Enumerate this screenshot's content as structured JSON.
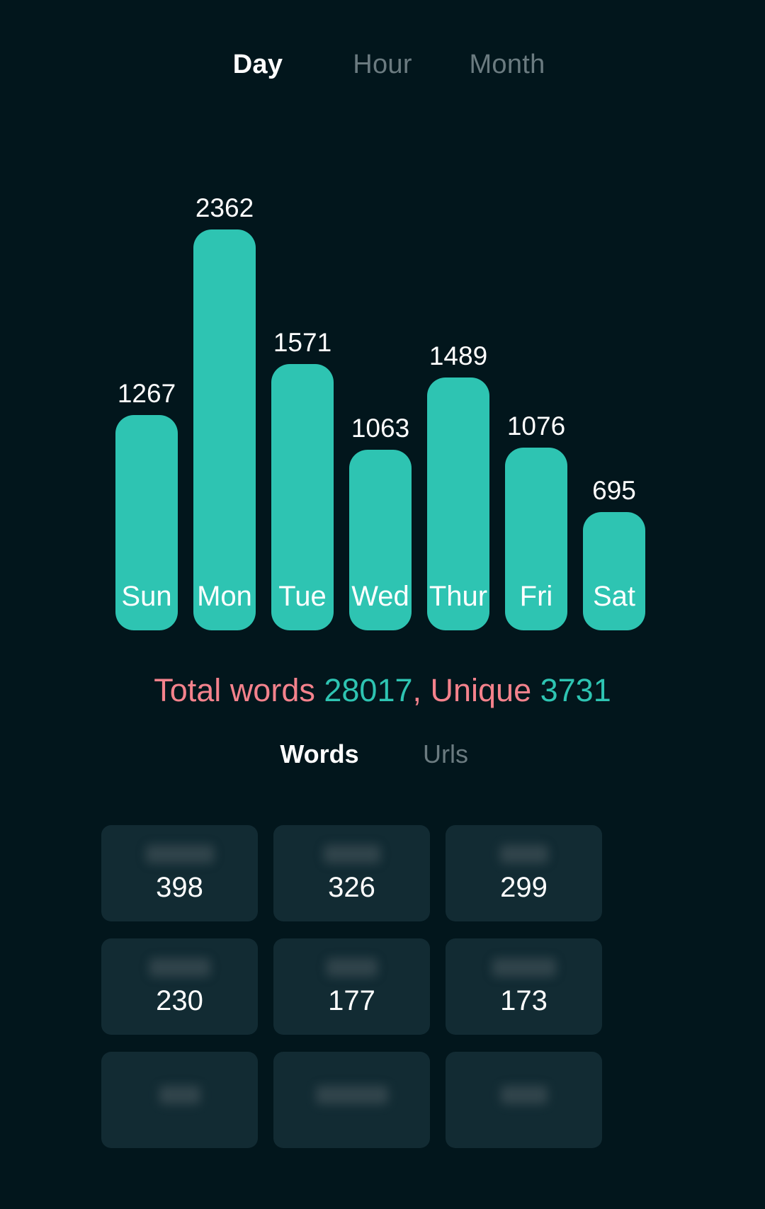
{
  "period_tabs": [
    {
      "label": "Day",
      "active": true
    },
    {
      "label": "Hour",
      "active": false
    },
    {
      "label": "Month",
      "active": false
    }
  ],
  "chart_data": {
    "type": "bar",
    "title": "",
    "xlabel": "",
    "ylabel": "",
    "categories": [
      "Sun",
      "Mon",
      "Tue",
      "Wed",
      "Thur",
      "Fri",
      "Sat"
    ],
    "values": [
      1267,
      2362,
      1571,
      1063,
      1489,
      1076,
      695
    ],
    "ylim": [
      0,
      2362
    ],
    "grid": false,
    "legend": "none",
    "bar_color": "#2ec4b2",
    "value_label_color": "#ffffff"
  },
  "totals": {
    "words_label": "Total words",
    "words_value": "28017",
    "unique_label": ", Unique",
    "unique_value": "3731",
    "label_color": "#f4828c",
    "value_color": "#2ec4b2"
  },
  "list_tabs": [
    {
      "label": "Words",
      "active": true
    },
    {
      "label": "Urls",
      "active": false
    }
  ],
  "word_cards": [
    {
      "word": "",
      "count": "398",
      "blur_width": 96
    },
    {
      "word": "",
      "count": "326",
      "blur_width": 80
    },
    {
      "word": "",
      "count": "299",
      "blur_width": 68
    },
    {
      "word": "",
      "count": "230",
      "blur_width": 86
    },
    {
      "word": "",
      "count": "177",
      "blur_width": 72
    },
    {
      "word": "",
      "count": "173",
      "blur_width": 90
    },
    {
      "word": "",
      "count": "",
      "blur_width": 58
    },
    {
      "word": "",
      "count": "",
      "blur_width": 102
    },
    {
      "word": "",
      "count": "",
      "blur_width": 66
    }
  ],
  "colors": {
    "background": "#02161c",
    "accent_teal": "#2ec4b2",
    "accent_olive": "#9cc46e",
    "accent_pink": "#f4828c",
    "inactive_text": "#6b7b80",
    "card_background": "#122b33"
  }
}
